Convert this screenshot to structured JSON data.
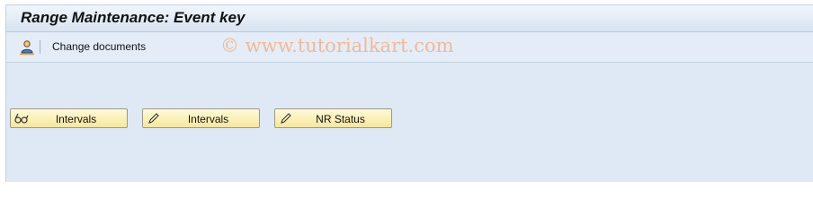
{
  "title": "Range Maintenance: Event key",
  "toolbar": {
    "change_documents_label": "Change documents",
    "icon": "change-documents-icon"
  },
  "watermark": "© www.tutorialkart.com",
  "buttons": [
    {
      "label": "Intervals",
      "icon": "glasses-icon"
    },
    {
      "label": "Intervals",
      "icon": "pencil-icon"
    },
    {
      "label": "NR Status",
      "icon": "pencil-icon"
    }
  ]
}
